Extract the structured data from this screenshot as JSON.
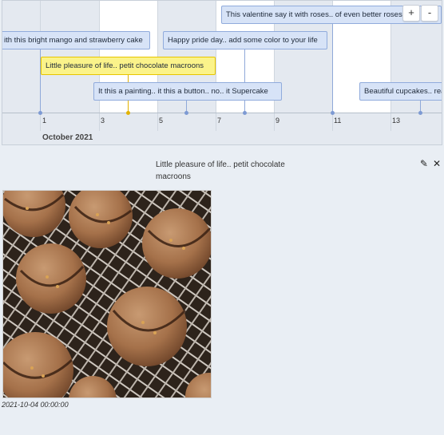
{
  "timeline": {
    "month_label": "October 2021",
    "ticks": [
      "1",
      "3",
      "5",
      "7",
      "9",
      "11",
      "13"
    ],
    "items": [
      {
        "label": "ith this bright mango and strawberry cake"
      },
      {
        "label": "Little pleasure of life.. petit chocolate macroons",
        "selected": true
      },
      {
        "label": "It this a painting.. it this a button.. no.. it Supercake"
      },
      {
        "label": "Happy pride day.. add some color to your life"
      },
      {
        "label": "This valentine say it with roses.. of even better roses"
      },
      {
        "label": "Beautiful cupcakes.. read"
      }
    ],
    "zoom_in_label": "+",
    "zoom_out_label": "-"
  },
  "detail": {
    "title": "Little pleasure of life.. petit chocolate macroons",
    "edit_icon": "pencil-icon",
    "close_icon": "close-icon",
    "timestamp": "2021-10-04 00:00:00",
    "image_subject": "chocolate macarons with drizzle and nuts on cooling rack"
  }
}
